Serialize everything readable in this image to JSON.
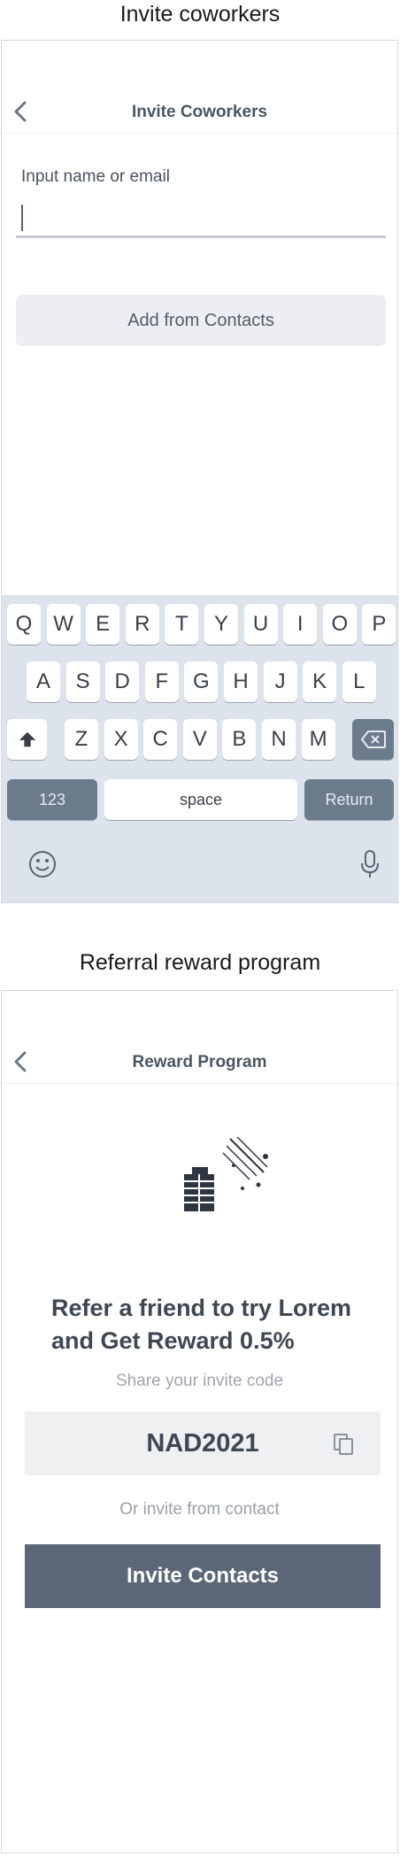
{
  "screen_invite": {
    "caption": "Invite coworkers",
    "nav_title": "Invite Coworkers",
    "field_label": "Input name or email",
    "input_value": "",
    "add_contacts_label": "Add from Contacts",
    "keyboard": {
      "row1": [
        "Q",
        "W",
        "E",
        "R",
        "T",
        "Y",
        "U",
        "I",
        "O",
        "P"
      ],
      "row2": [
        "A",
        "S",
        "D",
        "F",
        "G",
        "H",
        "J",
        "K",
        "L"
      ],
      "row3": [
        "Z",
        "X",
        "C",
        "V",
        "B",
        "N",
        "M"
      ],
      "numbers_key": "123",
      "space_key": "space",
      "return_key": "Return"
    }
  },
  "screen_reward": {
    "caption": "Referral reward program",
    "nav_title": "Reward Program",
    "headline": "Refer a friend to try Lorem and Get Reward 0.5%",
    "share_label": "Share your invite code",
    "invite_code": "NAD2021",
    "or_label": "Or invite from contact",
    "invite_button": "Invite Contacts"
  },
  "colors": {
    "primary_button": "#5b6776",
    "nav_icon": "#6b7684",
    "keyboard_bg": "#dde3ec"
  }
}
